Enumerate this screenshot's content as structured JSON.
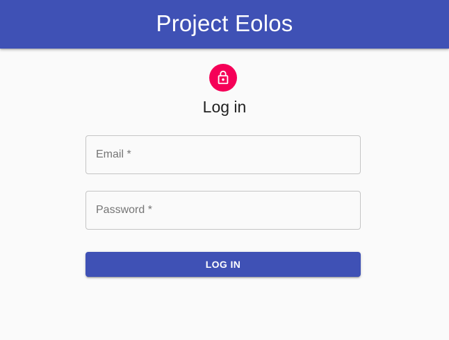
{
  "appbar": {
    "title": "Project Eolos"
  },
  "icons": {
    "avatar_icon": "lock-icon"
  },
  "colors": {
    "primary": "#3f51b5",
    "secondary": "#f50057",
    "background": "#fafafa"
  },
  "form": {
    "heading": "Log in",
    "email": {
      "label": "Email *",
      "value": ""
    },
    "password": {
      "label": "Password *",
      "value": ""
    },
    "submit_label": "LOG IN"
  }
}
